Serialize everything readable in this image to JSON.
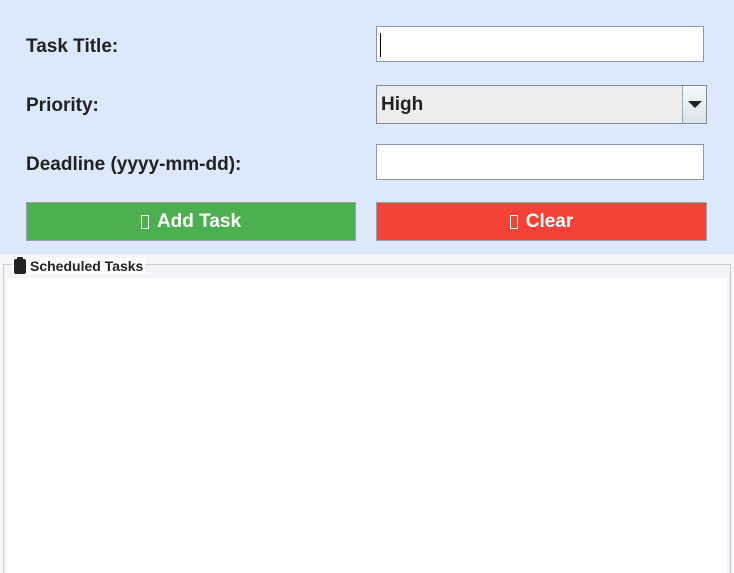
{
  "form": {
    "title_label": "Task Title:",
    "title_value": "",
    "priority_label": "Priority:",
    "priority_value": "High",
    "deadline_label": "Deadline (yyyy-mm-dd):",
    "deadline_value": ""
  },
  "buttons": {
    "add_label": "Add Task",
    "clear_label": "Clear",
    "add_color": "#4caf50",
    "clear_color": "#f44336"
  },
  "tasks": {
    "title": "Scheduled Tasks",
    "items": []
  },
  "icons": {
    "add": "missing-glyph-icon",
    "clear": "missing-glyph-icon",
    "tasks": "clipboard-icon"
  }
}
